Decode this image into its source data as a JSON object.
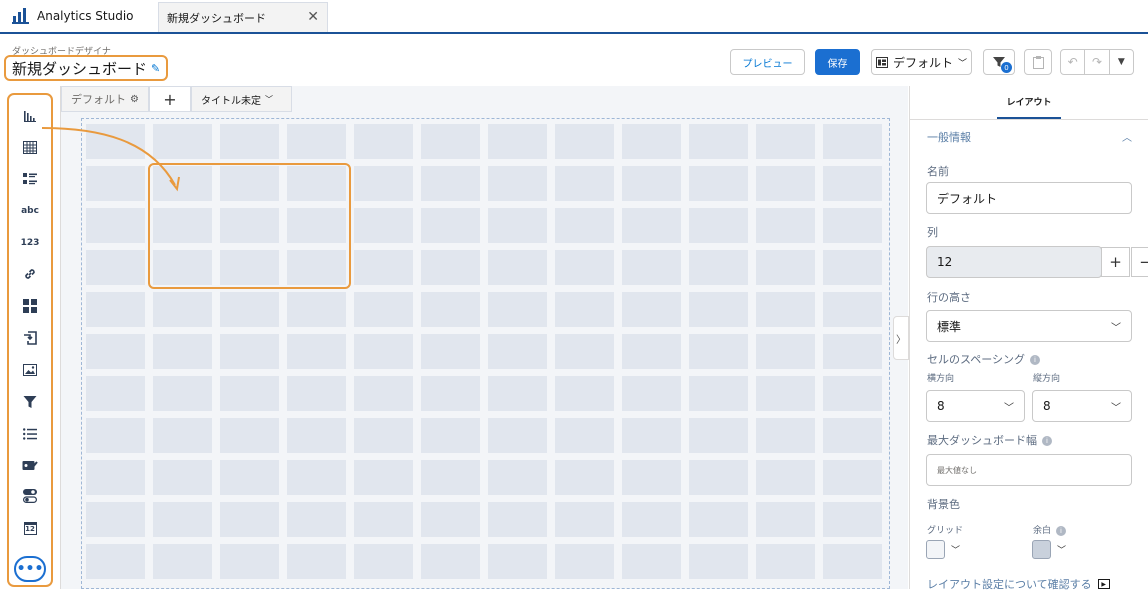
{
  "app": {
    "name": "Analytics Studio"
  },
  "tab": {
    "label": "新規ダッシュボード",
    "close": "✕"
  },
  "header": {
    "subtitle": "ダッシュボードデザイナ",
    "title": "新規ダッシュボード",
    "preview_label": "プレビュー",
    "save_label": "保存",
    "layout_select": "デフォルト",
    "filter_count": "0"
  },
  "tools": [
    "bar-chart",
    "table",
    "list-widget",
    "text",
    "number",
    "link",
    "container",
    "navigate",
    "image",
    "filter",
    "list",
    "date-picker",
    "toggle",
    "calendar"
  ],
  "tool_text": {
    "text": "abc",
    "number": "123",
    "calendar": "12"
  },
  "more_label": "•••",
  "page_tabs": {
    "default": "デフォルト",
    "untitled": "タイトル未定"
  },
  "grid": {
    "columns": 12,
    "rows": 11
  },
  "panel": {
    "tab": "レイアウト",
    "section": "一般情報",
    "name_label": "名前",
    "name_value": "デフォルト",
    "columns_label": "列",
    "columns_value": "12",
    "row_height_label": "行の高さ",
    "row_height_value": "標準",
    "spacing_label": "セルのスペーシング",
    "horizontal_label": "横方向",
    "horizontal_value": "8",
    "vertical_label": "縦方向",
    "vertical_value": "8",
    "max_width_label": "最大ダッシュボード幅",
    "max_width_placeholder": "最大値なし",
    "bg_label": "背景色",
    "grid_label": "グリッド",
    "margin_label": "余白",
    "help_link": "レイアウト設定について確認する"
  },
  "colors": {
    "accent": "#1b6fd1",
    "highlight": "#e99a3e",
    "grid_swatch": "#f3f5f8",
    "margin_swatch": "#c9d1dc"
  }
}
